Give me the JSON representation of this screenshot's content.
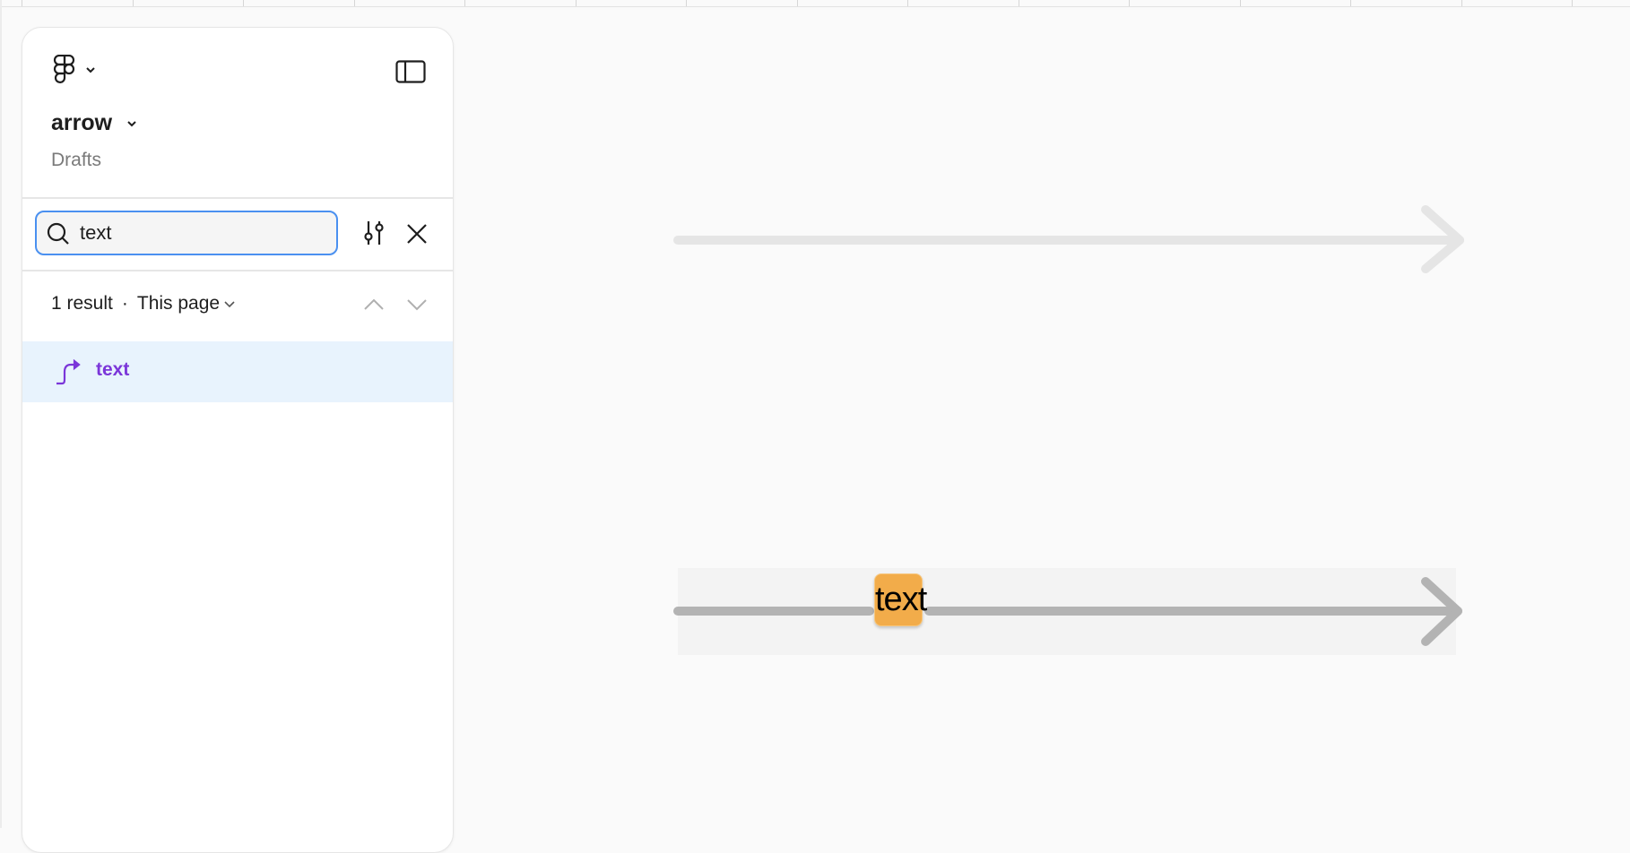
{
  "sidebar": {
    "logo_icon": "figma-logo-icon",
    "file_title": "arrow",
    "file_location": "Drafts",
    "toggle_icon": "sidebar-toggle-icon",
    "search": {
      "value": "text",
      "placeholder": "",
      "filter_icon": "sliders-icon",
      "clear_icon": "close-icon"
    },
    "results": {
      "count_label": "1 result",
      "separator": "·",
      "scope_label": "This page",
      "prev_icon": "chevron-up-icon",
      "next_icon": "chevron-down-icon",
      "items": [
        {
          "label": "text",
          "icon": "connector-icon",
          "selected": true
        }
      ]
    }
  },
  "canvas": {
    "arrows": [
      {
        "label": "",
        "color": "#e5e5e5"
      },
      {
        "label": "text",
        "color": "#b3b3b3",
        "label_bg": "#f2ac4a",
        "highlighted": true
      }
    ]
  },
  "colors": {
    "accent": "#4a90f0",
    "result_text": "#7b36d9",
    "selection_bg": "#e8f3fd"
  }
}
